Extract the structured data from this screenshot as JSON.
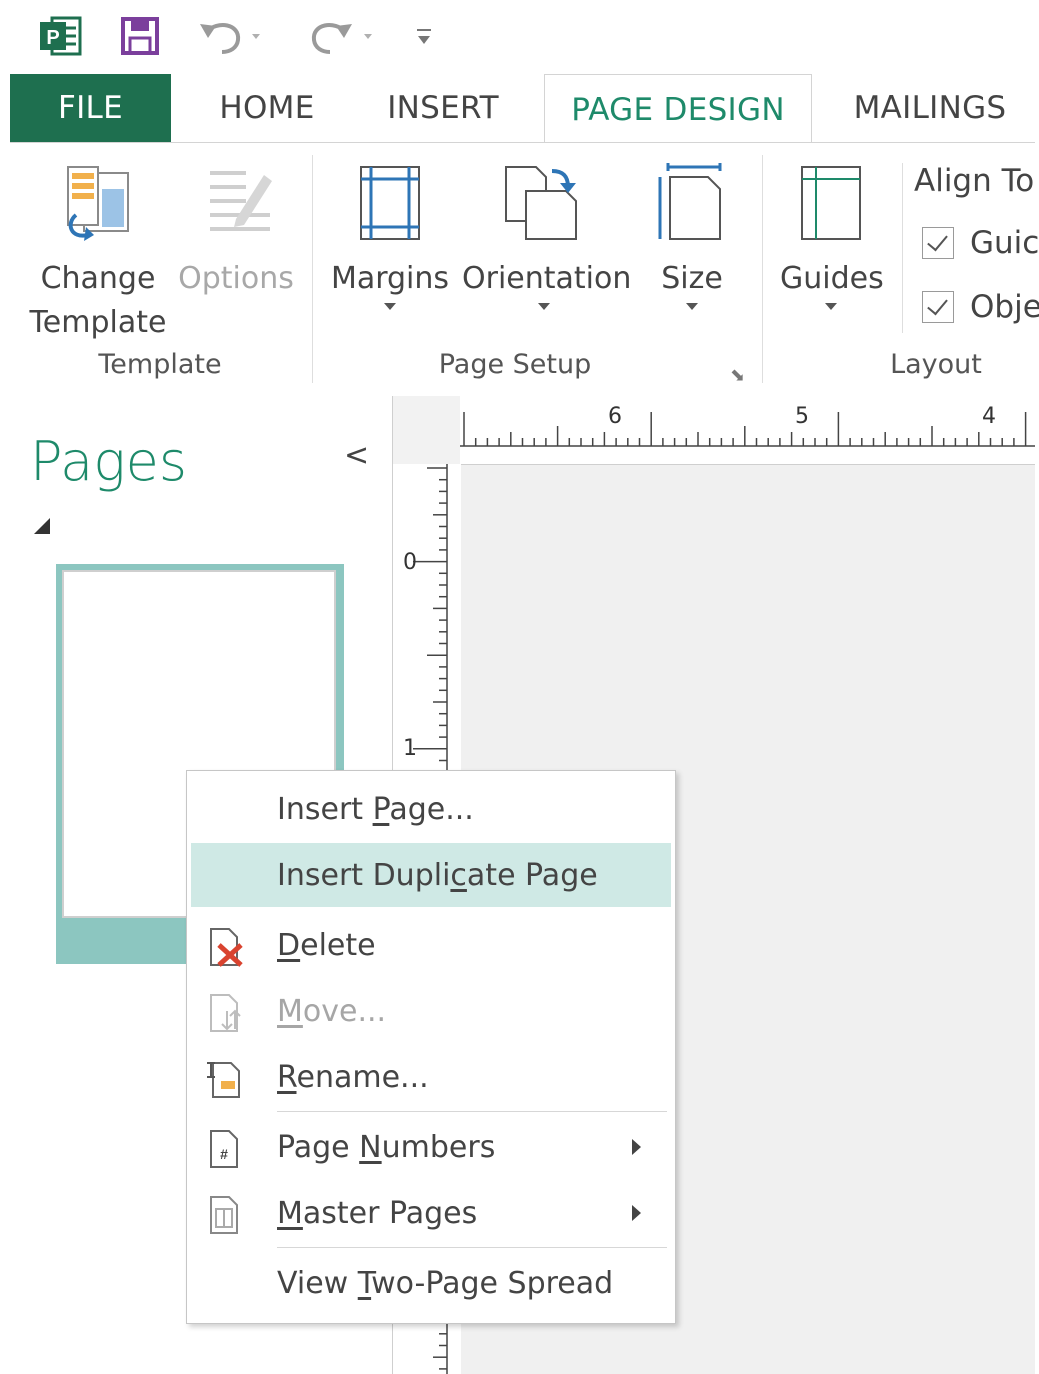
{
  "qat": {
    "app_icon_letter": "P",
    "undo_label": "Undo",
    "redo_label": "Redo"
  },
  "tabs": [
    {
      "label": "FILE"
    },
    {
      "label": "HOME"
    },
    {
      "label": "INSERT"
    },
    {
      "label": "PAGE DESIGN",
      "active": true
    },
    {
      "label": "MAILINGS"
    }
  ],
  "ribbon": {
    "change_template": {
      "line1": "Change",
      "line2": "Template"
    },
    "options": "Options",
    "margins": "Margins",
    "orientation": "Orientation",
    "size": "Size",
    "guides": "Guides",
    "align_to": "Align To",
    "checkbox_1": "Guides",
    "checkbox_2": "Objects",
    "checkbox_1_visible": "Guic",
    "checkbox_2_visible": "Obje",
    "group_template": "Template",
    "group_page_setup": "Page Setup",
    "group_layout": "Layout"
  },
  "pages_pane": {
    "title": "Pages",
    "collapse_glyph": "<"
  },
  "rulers": {
    "h_numbers": [
      "6",
      "5",
      "4"
    ],
    "v_numbers": [
      "0",
      "1"
    ]
  },
  "context_menu": {
    "items": [
      {
        "pre": "Insert ",
        "acc": "P",
        "post": "age...",
        "enabled": true
      },
      {
        "pre": "Insert Dupli",
        "acc": "c",
        "post": "ate Page",
        "enabled": true,
        "highlighted": true
      },
      {
        "pre": "",
        "acc": "D",
        "post": "elete",
        "enabled": true,
        "icon": "delete-page-icon"
      },
      {
        "pre": "",
        "acc": "M",
        "post": "ove...",
        "enabled": false,
        "icon": "move-page-icon"
      },
      {
        "pre": "",
        "acc": "R",
        "post": "ename...",
        "enabled": true,
        "icon": "rename-page-icon"
      },
      {
        "pre": "Page ",
        "acc": "N",
        "post": "umbers",
        "enabled": true,
        "icon": "page-numbers-icon",
        "submenu": true
      },
      {
        "pre": "",
        "acc": "M",
        "post": "aster Pages",
        "enabled": true,
        "icon": "master-pages-icon",
        "submenu": true
      },
      {
        "pre": "View ",
        "acc": "T",
        "post": "wo-Page Spread",
        "enabled": true
      }
    ]
  },
  "colors": {
    "accent": "#1e8a6a",
    "file_tab": "#1e6f4f",
    "selection": "#8cc6c0",
    "menu_hover": "#cfe9e5",
    "delete_red": "#d9432f"
  }
}
